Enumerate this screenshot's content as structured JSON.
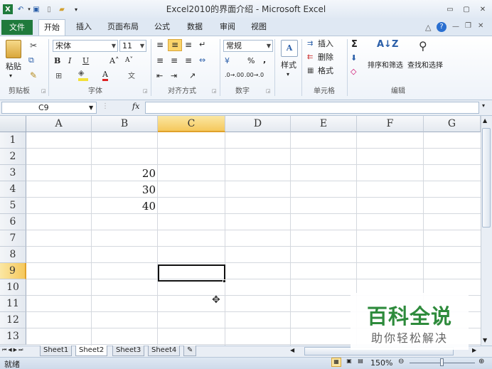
{
  "window": {
    "title": "Excel2010的界面介绍 - Microsoft Excel",
    "controls": [
      "▭",
      "▢",
      "✕"
    ]
  },
  "ribbon_tabs": [
    {
      "label": "文件"
    },
    {
      "label": "开始"
    },
    {
      "label": "插入"
    },
    {
      "label": "页面布局"
    },
    {
      "label": "公式"
    },
    {
      "label": "数据"
    },
    {
      "label": "审阅"
    },
    {
      "label": "视图"
    }
  ],
  "ribbon": {
    "clipboard": {
      "paste_label": "粘贴",
      "group_label": "剪贴板"
    },
    "font": {
      "font_name": "宋体",
      "font_size": "11",
      "group_label": "字体"
    },
    "alignment": {
      "group_label": "对齐方式"
    },
    "number": {
      "format": "常规",
      "percent": "%",
      "comma": ",",
      "group_label": "数字"
    },
    "styles": {
      "label": "样式"
    },
    "cells": {
      "insert_label": "插入",
      "delete_label": "删除",
      "format_label": "格式",
      "group_label": "单元格"
    },
    "editing": {
      "sort_filter_label": "排序和筛选",
      "find_select_label": "查找和选择",
      "group_label": "编辑"
    }
  },
  "formula_bar": {
    "name_box": "C9",
    "fx_label": "fx",
    "value": ""
  },
  "grid": {
    "columns": [
      "A",
      "B",
      "C",
      "D",
      "E",
      "F",
      "G"
    ],
    "rows": [
      "1",
      "2",
      "3",
      "4",
      "5",
      "6",
      "7",
      "8",
      "9",
      "10",
      "11",
      "12",
      "13"
    ],
    "selected_column": "C",
    "selected_row": "9",
    "active_cell": "C9",
    "cells": [
      {
        "ref": "B3",
        "value": "20"
      },
      {
        "ref": "B4",
        "value": "30"
      },
      {
        "ref": "B5",
        "value": "40"
      }
    ]
  },
  "sheets": [
    {
      "label": "Sheet1",
      "active": false
    },
    {
      "label": "Sheet2",
      "active": true
    },
    {
      "label": "Sheet3",
      "active": false
    },
    {
      "label": "Sheet4",
      "active": false
    }
  ],
  "status": {
    "mode": "就绪",
    "zoom": "150%"
  },
  "watermark": {
    "title": "百科全说",
    "subtitle": "助你轻松解决"
  },
  "colors": {
    "file_tab": "#1f7a3c",
    "selection_header": "#f5c85c",
    "watermark_green": "#2e8b3c"
  }
}
